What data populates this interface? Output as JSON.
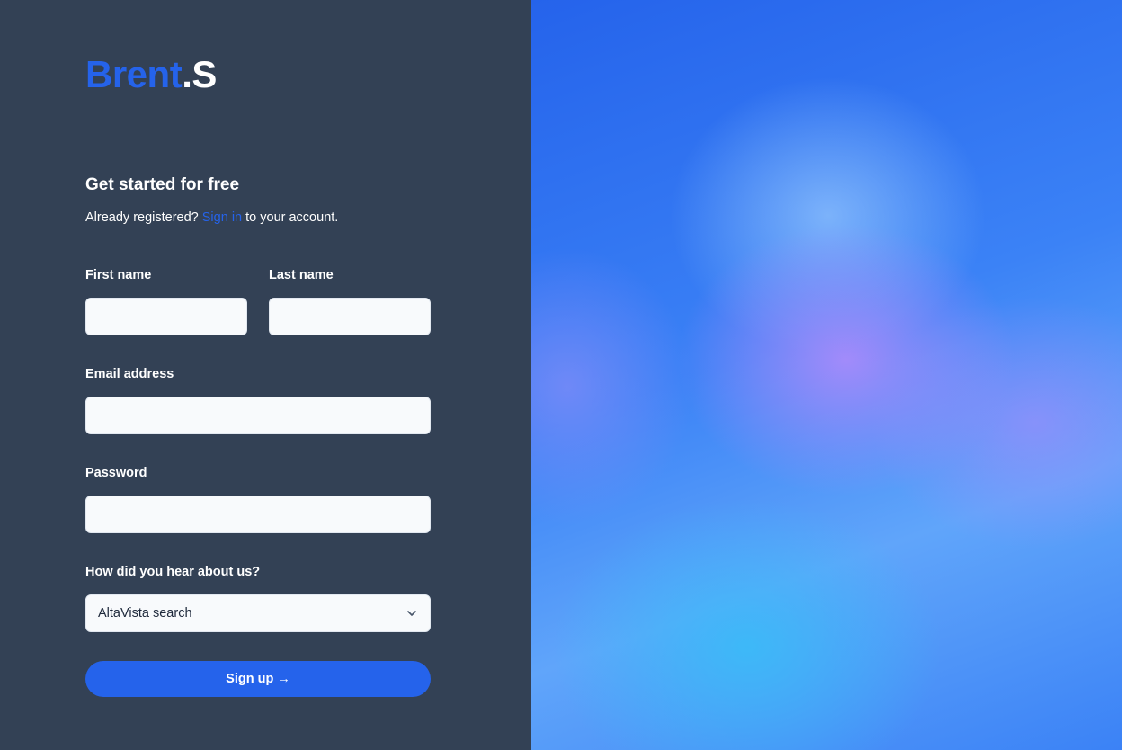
{
  "brand": {
    "name_part1": "Brent",
    "name_part2": ".S",
    "primary_color": "#2563eb"
  },
  "form": {
    "heading": "Get started for free",
    "subtext_prefix": "Already registered? ",
    "signin_link": "Sign in",
    "subtext_suffix": " to your account.",
    "first_name": {
      "label": "First name",
      "value": ""
    },
    "last_name": {
      "label": "Last name",
      "value": ""
    },
    "email": {
      "label": "Email address",
      "value": ""
    },
    "password": {
      "label": "Password",
      "value": ""
    },
    "referral": {
      "label": "How did you hear about us?",
      "selected": "AltaVista search"
    },
    "submit_label": "Sign up →"
  },
  "colors": {
    "panel_background": "#334155",
    "input_background": "#f8fafc",
    "button_background": "#2563eb"
  }
}
